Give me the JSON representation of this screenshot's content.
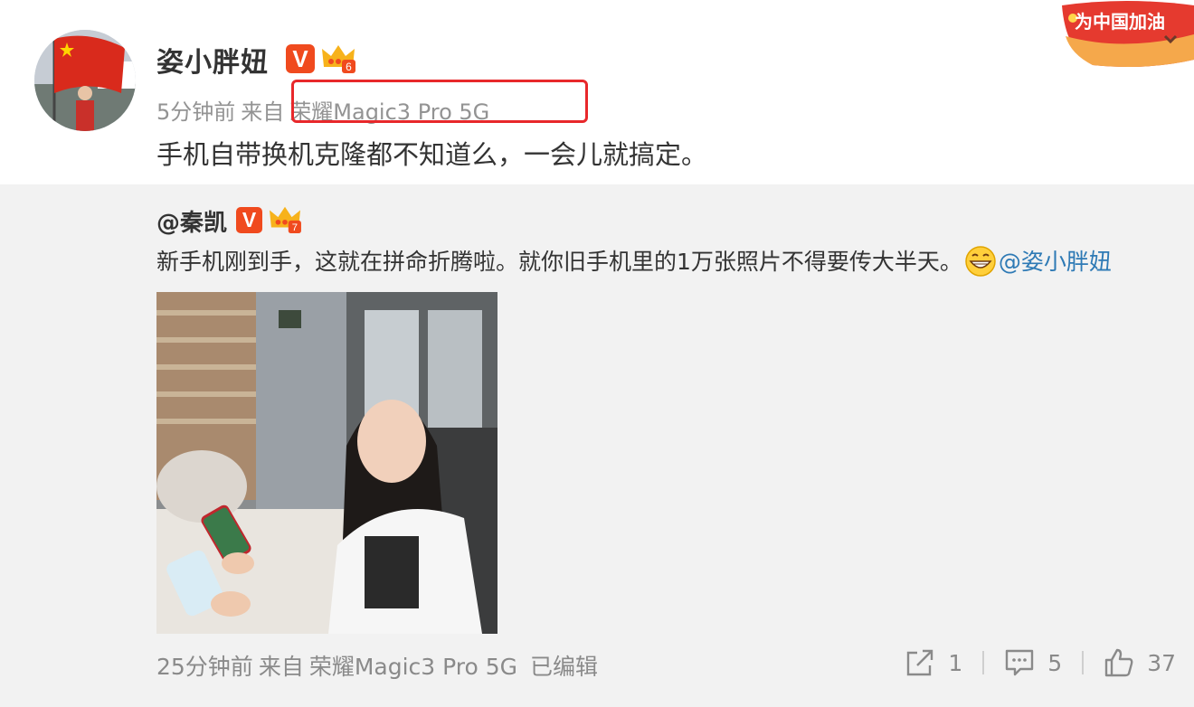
{
  "post": {
    "author": "姿小胖妞",
    "vip_badge": "V",
    "crown_level": "6",
    "time": "5分钟前",
    "source_prefix": "来自",
    "source": "荣耀Magic3 Pro 5G",
    "text": "手机自带换机克隆都不知道么，一会儿就搞定。"
  },
  "banner": {
    "text": "为中国加油"
  },
  "repost": {
    "author": "@秦凯",
    "vip_badge": "V",
    "crown_level": "7",
    "text": "新手机刚到手，这就在拼命折腾啦。就你旧手机里的1万张照片不得要传大半天。",
    "emoji": "grin-emoji",
    "mention": "@姿小胖妞",
    "time": "25分钟前",
    "source_prefix": "来自",
    "source": "荣耀Magic3 Pro 5G",
    "edited": "已编辑"
  },
  "actions": {
    "repost_count": "1",
    "comment_count": "5",
    "like_count": "37"
  },
  "colors": {
    "vip_red": "#f04a1e",
    "highlight_red": "#e8282b",
    "mention_blue": "#2e7ab5",
    "repost_bg": "#f2f2f2"
  }
}
